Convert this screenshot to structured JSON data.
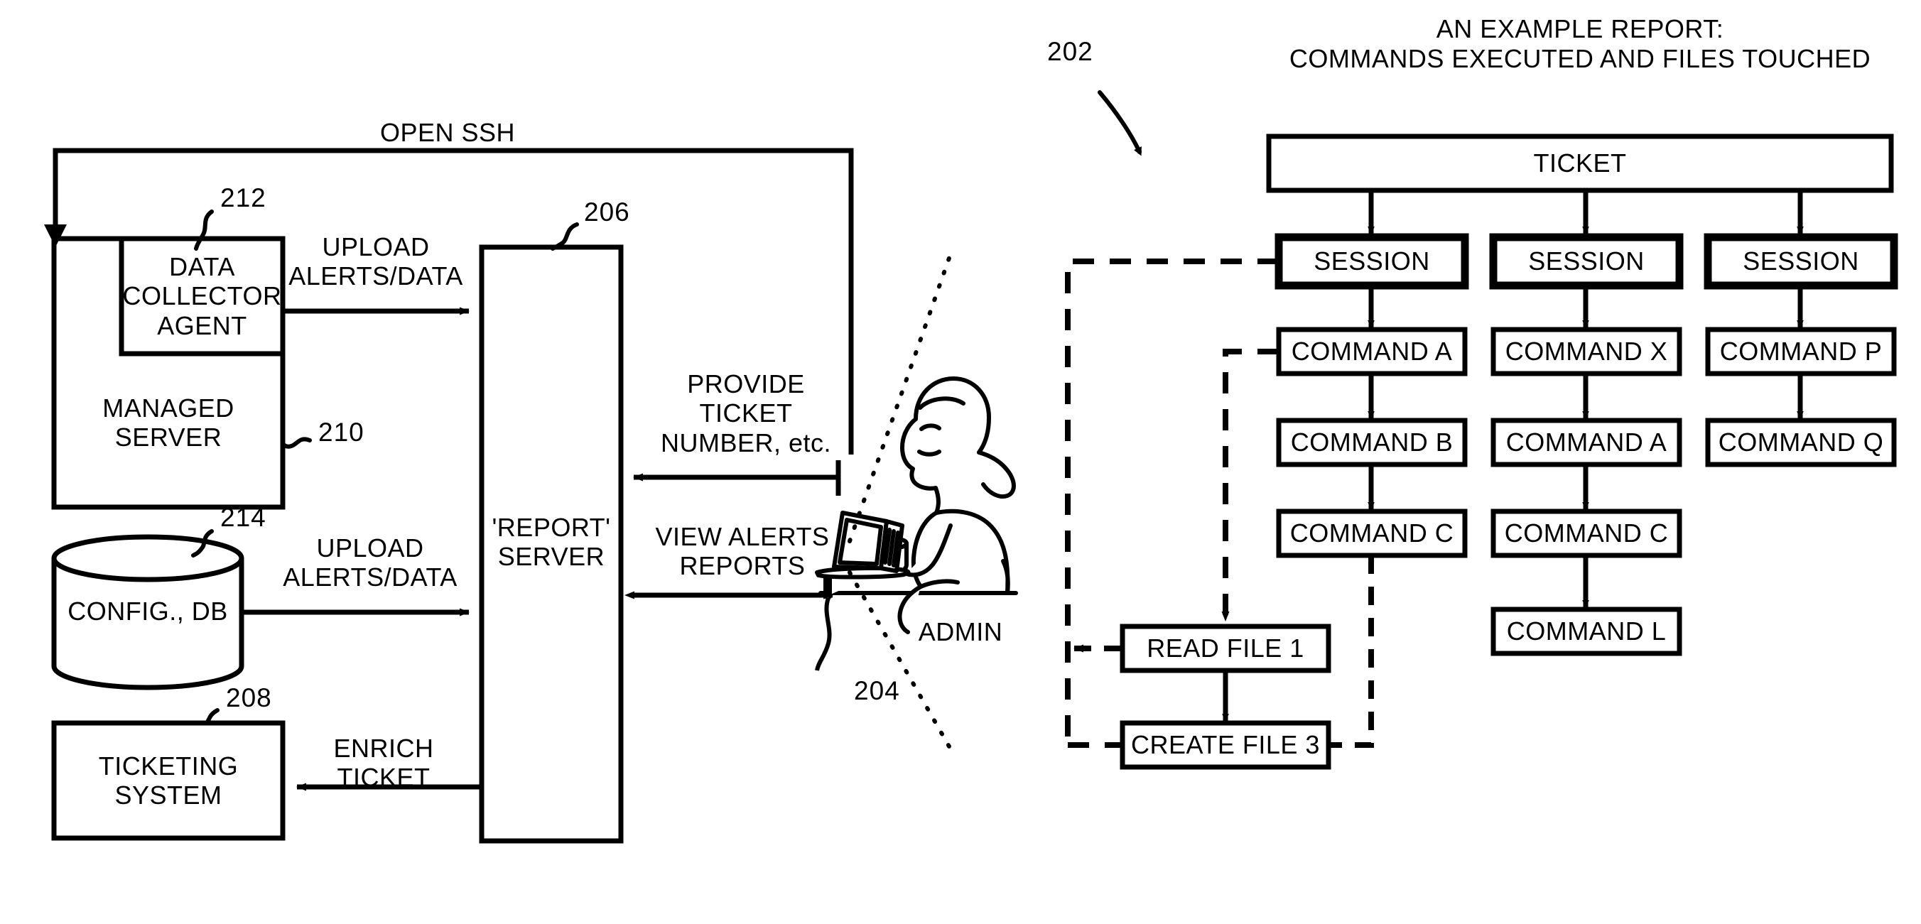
{
  "figure": {
    "report_heading_line1": "AN EXAMPLE REPORT:",
    "report_heading_line2": "COMMANDS EXECUTED AND FILES TOUCHED",
    "ref_202": "202",
    "ref_204": "204",
    "ref_206": "206",
    "ref_208": "208",
    "ref_210": "210",
    "ref_212": "212",
    "ref_214": "214"
  },
  "left_system": {
    "managed_server": "MANAGED\nSERVER",
    "data_collector_agent": "DATA\nCOLLECTOR\nAGENT",
    "config_db": "CONFIG., DB",
    "ticketing_system": "TICKETING\nSYSTEM",
    "report_server": "'REPORT'\nSERVER",
    "admin_label": "ADMIN"
  },
  "arrow_labels": {
    "open_ssh": "OPEN SSH",
    "upload_alerts_data_top": "UPLOAD\nALERTS/DATA",
    "upload_alerts_data_bottom": "UPLOAD\nALERTS/DATA",
    "enrich_ticket": "ENRICH TICKET",
    "provide_ticket_number": "PROVIDE\nTICKET\nNUMBER, etc.",
    "view_alerts_reports": "VIEW ALERTS\nREPORTS"
  },
  "report_tree": {
    "root": "TICKET",
    "columns": [
      {
        "session": "SESSION",
        "commands": [
          "COMMAND A",
          "COMMAND B",
          "COMMAND C"
        ]
      },
      {
        "session": "SESSION",
        "commands": [
          "COMMAND X",
          "COMMAND A",
          "COMMAND C",
          "COMMAND L"
        ]
      },
      {
        "session": "SESSION",
        "commands": [
          "COMMAND P",
          "COMMAND Q"
        ]
      }
    ],
    "files": [
      "READ FILE 1",
      "CREATE FILE 3"
    ]
  },
  "colors": {
    "ink": "#000000",
    "paper": "#ffffff"
  }
}
